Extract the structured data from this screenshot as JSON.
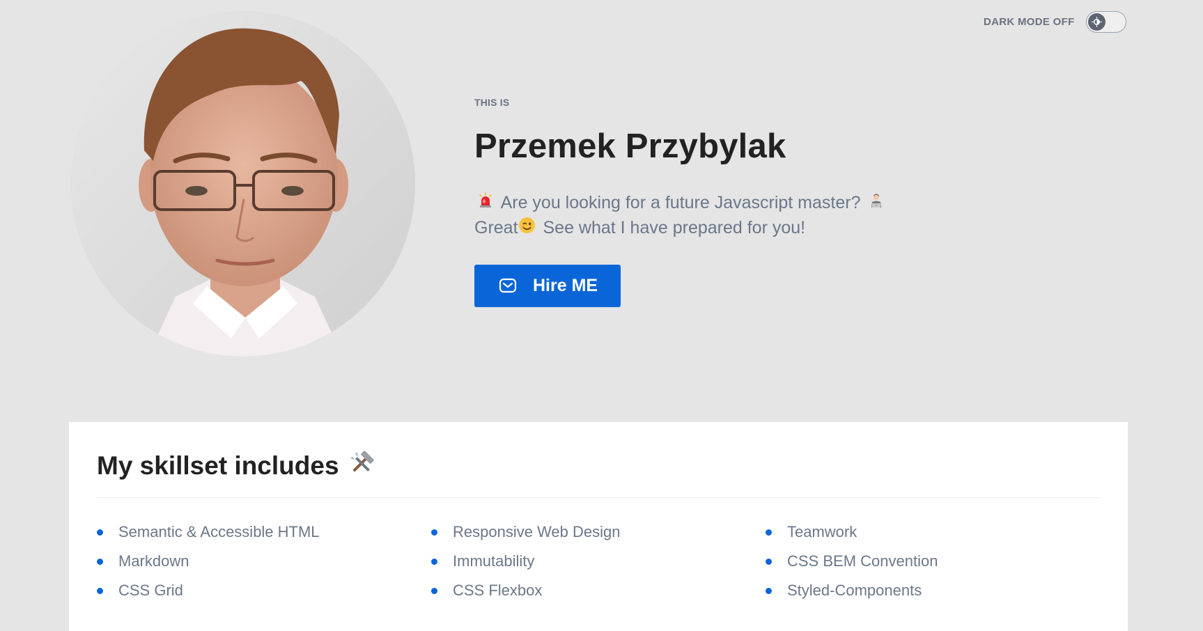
{
  "dark_mode": {
    "label": "DARK MODE OFF",
    "enabled": false
  },
  "hero": {
    "eyebrow": "THIS IS",
    "name": "Przemek Przybylak",
    "intro_line1": "Are you looking for a future Javascript master?",
    "intro_line2_start": "Great",
    "intro_line2_end": "See what I have prepared for you!",
    "hire_button_label": "Hire ME"
  },
  "skills": {
    "title": "My skillset includes",
    "items": [
      "Semantic & Accessible HTML",
      "Responsive Web Design",
      "Teamwork",
      "Markdown",
      "Immutability",
      "CSS BEM Convention",
      "CSS Grid",
      "CSS Flexbox",
      "Styled-Components"
    ]
  },
  "colors": {
    "accent": "#0a66d8",
    "background": "#e5e5e5",
    "muted_text": "#6b7789"
  },
  "icons": {
    "toggle": "sun-icon",
    "hire": "envelope-icon",
    "alarm": "police-light-emoji",
    "developer": "technologist-emoji",
    "wink": "winking-face-emoji",
    "tools": "hammer-and-wrench-emoji"
  }
}
